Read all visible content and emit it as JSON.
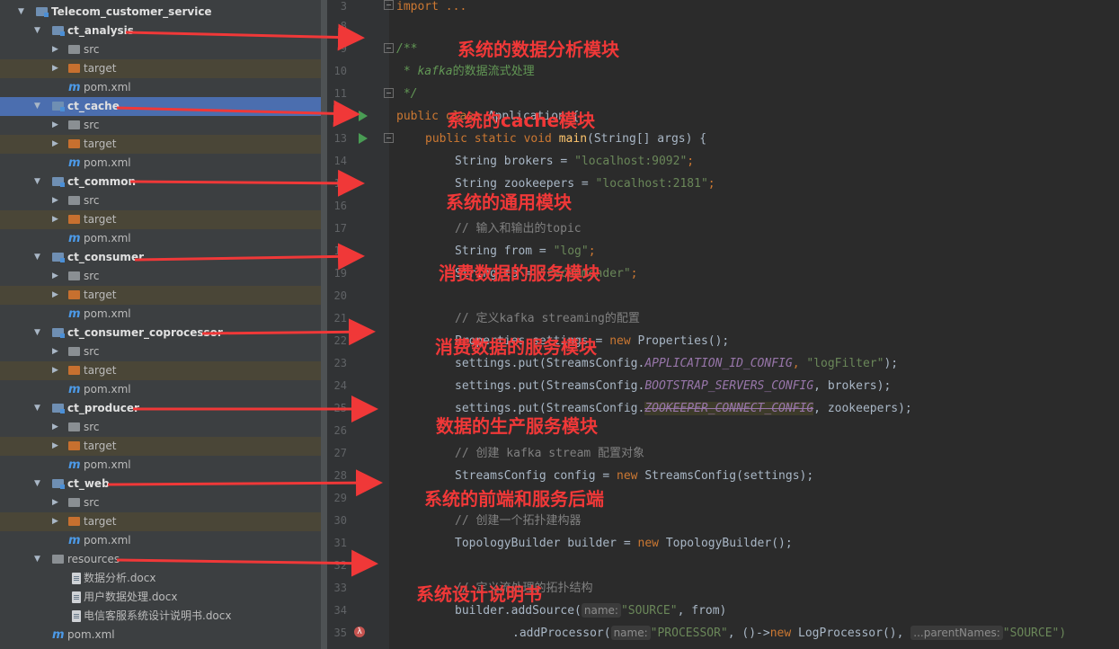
{
  "project_tree": {
    "root": "Telecom_customer_service",
    "modules": [
      {
        "name": "ct_analysis",
        "children": [
          "src",
          "target",
          "pom.xml"
        ]
      },
      {
        "name": "ct_cache",
        "children": [
          "src",
          "target",
          "pom.xml"
        ]
      },
      {
        "name": "ct_common",
        "children": [
          "src",
          "target",
          "pom.xml"
        ]
      },
      {
        "name": "ct_consumer",
        "children": [
          "src",
          "target",
          "pom.xml"
        ]
      },
      {
        "name": "ct_consumer_coprocessor",
        "children": [
          "src",
          "target",
          "pom.xml"
        ]
      },
      {
        "name": "ct_producer",
        "children": [
          "src",
          "target",
          "pom.xml"
        ]
      },
      {
        "name": "ct_web",
        "children": [
          "src",
          "target",
          "pom.xml"
        ]
      }
    ],
    "resources": {
      "name": "resources",
      "files": [
        "数据分析.docx",
        "用户数据处理.docx",
        "电信客服系统设计说明书.docx"
      ]
    },
    "root_pom": "pom.xml"
  },
  "line_numbers": [
    "3",
    "8",
    "9",
    "10",
    "11",
    "12",
    "13",
    "14",
    "15",
    "16",
    "17",
    "18",
    "19",
    "20",
    "21",
    "22",
    "23",
    "24",
    "25",
    "26",
    "27",
    "28",
    "29",
    "30",
    "31",
    "32",
    "33",
    "34",
    "35"
  ],
  "code": {
    "l3_import": "import ...",
    "l9": "/**",
    "l10_star": " * ",
    "l10_kafka": "kafka",
    "l10_rest": "的数据流式处理",
    "l11": " */",
    "l12_kw": "public class ",
    "l12_name": "Application ",
    "l12_brace": "{",
    "l13_kw": "public static void ",
    "l13_fn": "main",
    "l13_rest": "(String[] args) {",
    "l14_a": "String brokers = ",
    "l14_s": "\"localhost:9092\"",
    "l14_b": ";",
    "l15_a": "String zookeepers = ",
    "l15_s": "\"localhost:2181\"",
    "l15_b": ";",
    "l17": "// 输入和输出的topic",
    "l18_a": "String from = ",
    "l18_s": "\"log\"",
    "l18_b": ";",
    "l19_a": "String to = ",
    "l19_s": "\"recommender\"",
    "l19_b": ";",
    "l21": "// 定义kafka streaming的配置",
    "l22_a": "Properties settings = ",
    "l22_kw": "new ",
    "l22_b": "Properties();",
    "l23_a": "settings.put(StreamsConfig.",
    "l23_c": "APPLICATION_ID_CONFIG",
    "l23_m": ", ",
    "l23_s": "\"logFilter\"",
    "l23_b": ");",
    "l24_a": "settings.put(StreamsConfig.",
    "l24_c": "BOOTSTRAP_SERVERS_CONFIG",
    "l24_b": ", brokers);",
    "l25_a": "settings.put(StreamsConfig.",
    "l25_c": "ZOOKEEPER_CONNECT_CONFIG",
    "l25_b": ", zookeepers);",
    "l27": "// 创建 kafka stream 配置对象",
    "l28_a": "StreamsConfig config = ",
    "l28_kw": "new ",
    "l28_b": "StreamsConfig(settings);",
    "l30": "// 创建一个拓扑建构器",
    "l31_a": "TopologyBuilder builder = ",
    "l31_kw": "new ",
    "l31_b": "TopologyBuilder();",
    "l33": "// 定义流处理的拓扑结构",
    "l34_a": "builder.addSource(",
    "l34_hint": "name:",
    "l34_s": "\"SOURCE\"",
    "l34_b": ", from)",
    "l35_a": ".addProcessor(",
    "l35_hint1": "name:",
    "l35_s1": "\"PROCESSOR\"",
    "l35_m": ", ()->",
    "l35_kw": "new ",
    "l35_b": "LogProcessor(),",
    "l35_hint2": "...parentNames:",
    "l35_s2": "\"SOURCE\")"
  },
  "annotations": [
    "系统的数据分析模块",
    "系统的cache模块",
    "系统的通用模块",
    "消费数据的服务模块",
    "消费数据的服务模块",
    "数据的生产服务模块",
    "系统的前端和服务后端",
    "系统设计说明书"
  ],
  "colors": {
    "annotation": "#f03838",
    "selection": "#4b6eaf",
    "keyword": "#cc7832",
    "string": "#6a8759"
  }
}
